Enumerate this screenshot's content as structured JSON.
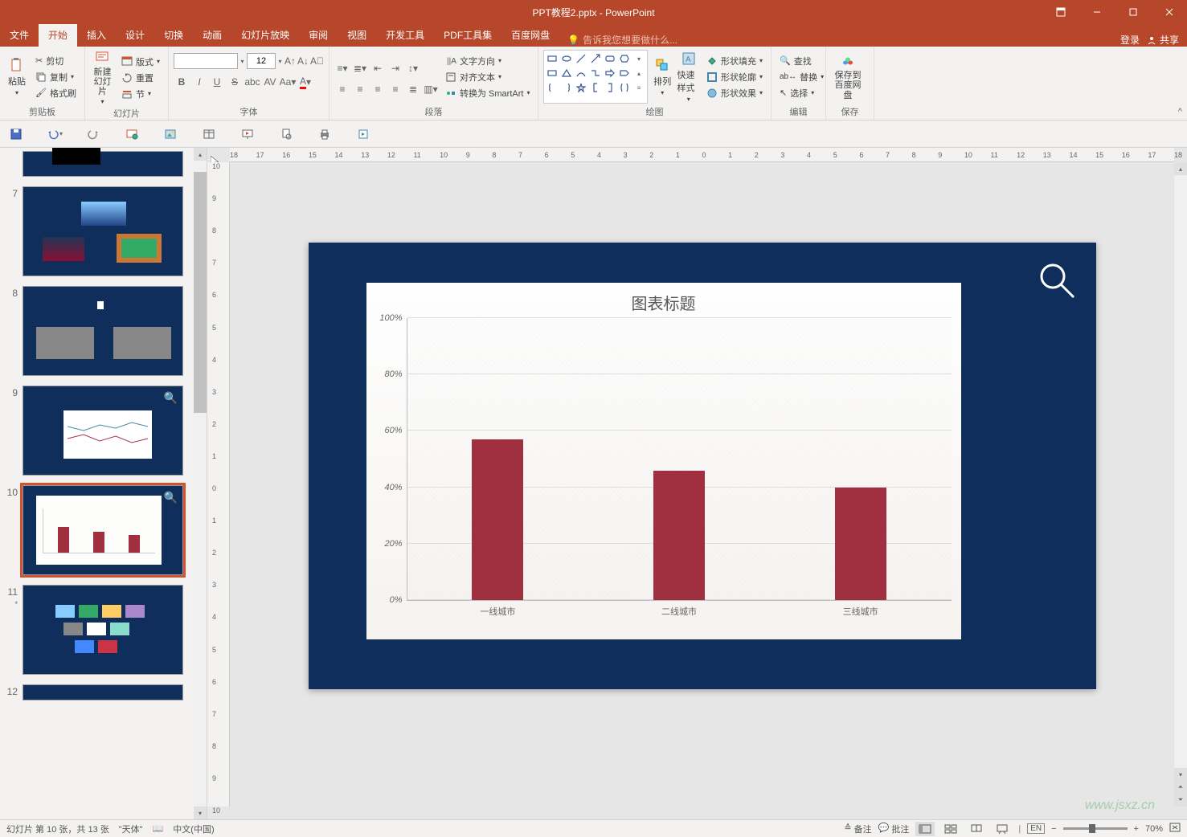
{
  "app": {
    "title": "PPT教程2.pptx - PowerPoint"
  },
  "tabs": {
    "file": "文件",
    "home": "开始",
    "insert": "插入",
    "design": "设计",
    "transitions": "切换",
    "animations": "动画",
    "slideshow": "幻灯片放映",
    "review": "审阅",
    "view": "视图",
    "developer": "开发工具",
    "pdf": "PDF工具集",
    "baidu": "百度网盘",
    "tellme": "告诉我您想要做什么...",
    "login": "登录",
    "share": "共享"
  },
  "ribbon": {
    "clipboard": {
      "label": "剪贴板",
      "paste": "粘贴",
      "cut": "剪切",
      "copy": "复制",
      "format_painter": "格式刷"
    },
    "slides": {
      "label": "幻灯片",
      "new_slide": "新建\n幻灯片",
      "layout": "版式",
      "reset": "重置",
      "section": "节"
    },
    "font": {
      "label": "字体",
      "size": "12"
    },
    "paragraph": {
      "label": "段落",
      "text_dir": "文字方向",
      "align_text": "对齐文本",
      "smartart": "转换为 SmartArt"
    },
    "drawing": {
      "label": "绘图",
      "arrange": "排列",
      "quick_styles": "快速样式",
      "shape_fill": "形状填充",
      "shape_outline": "形状轮廓",
      "shape_effects": "形状效果"
    },
    "editing": {
      "label": "编辑",
      "find": "查找",
      "replace": "替换",
      "select": "选择"
    },
    "save": {
      "label": "保存",
      "to_baidu": "保存到\n百度网盘"
    }
  },
  "thumbs": {
    "n7": "7",
    "n8": "8",
    "n9": "9",
    "n10": "10",
    "n11": "11",
    "n12": "12"
  },
  "ruler_h": [
    "18",
    "17",
    "16",
    "15",
    "14",
    "13",
    "12",
    "11",
    "10",
    "9",
    "8",
    "7",
    "6",
    "5",
    "4",
    "3",
    "2",
    "1",
    "0",
    "1",
    "2",
    "3",
    "4",
    "5",
    "6",
    "7",
    "8",
    "9",
    "10",
    "11",
    "12",
    "13",
    "14",
    "15",
    "16",
    "17",
    "18"
  ],
  "ruler_v": [
    "10",
    "9",
    "8",
    "7",
    "6",
    "5",
    "4",
    "3",
    "2",
    "1",
    "0",
    "1",
    "2",
    "3",
    "4",
    "5",
    "6",
    "7",
    "8",
    "9",
    "10"
  ],
  "chart_data": {
    "type": "bar",
    "title": "图表标题",
    "categories": [
      "一线城市",
      "二线城市",
      "三线城市"
    ],
    "values": [
      57,
      46,
      40
    ],
    "yticks": [
      0,
      20,
      40,
      60,
      80,
      100
    ],
    "ytick_labels": [
      "0%",
      "20%",
      "40%",
      "60%",
      "80%",
      "100%"
    ],
    "ylim": [
      0,
      100
    ],
    "bar_color": "#a03040"
  },
  "status": {
    "slide_info": "幻灯片 第 10 张，共 13 张",
    "theme": "\"天体\"",
    "lang": "中文(中国)",
    "notes": "备注",
    "comments": "批注",
    "zoom": "70%",
    "ime": "EN"
  },
  "watermark": "www.jsxz.cn"
}
